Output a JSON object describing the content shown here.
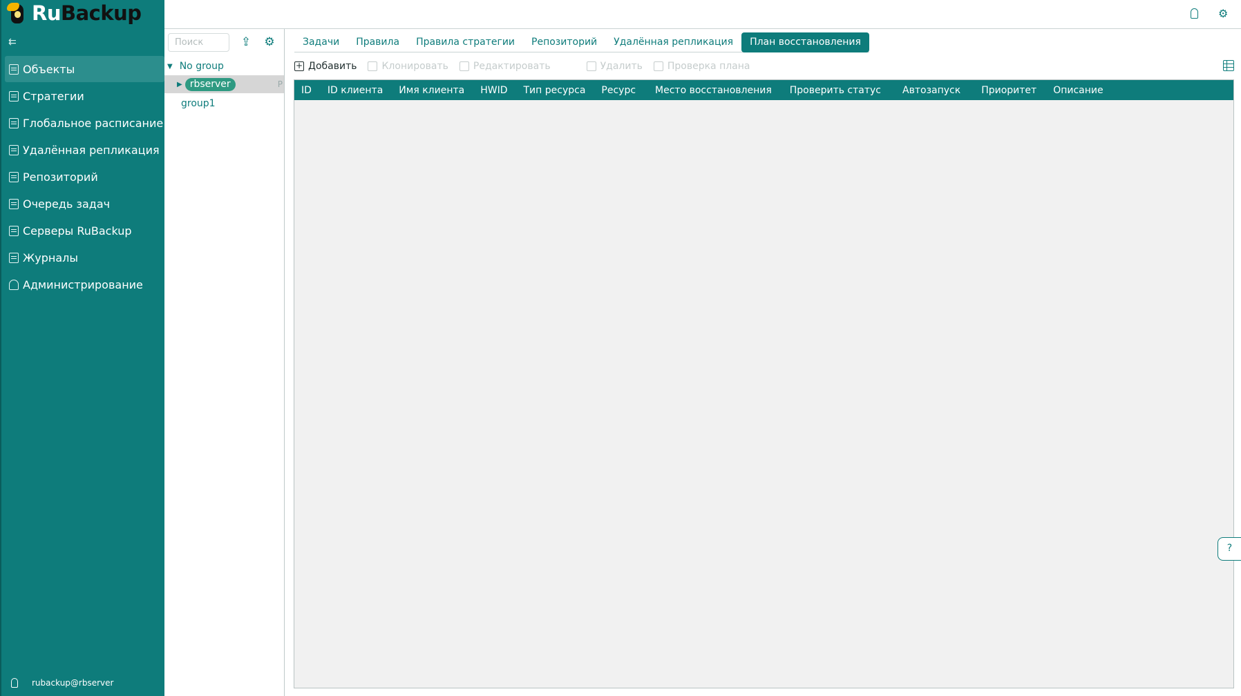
{
  "brand": {
    "ru": "Ru",
    "backup": "Backup"
  },
  "sidebar": {
    "collapse_icon": "collapse-sidebar-icon",
    "items": [
      {
        "label": "Объекты",
        "icon": "monitor-icon",
        "active": true
      },
      {
        "label": "Стратегии",
        "icon": "document-icon"
      },
      {
        "label": "Глобальное расписание",
        "icon": "calendar-icon"
      },
      {
        "label": "Удалённая репликация",
        "icon": "replication-icon"
      },
      {
        "label": "Репозиторий",
        "icon": "storage-icon"
      },
      {
        "label": "Очередь задач",
        "icon": "clipboard-icon"
      },
      {
        "label": "Серверы RuBackup",
        "icon": "server-icon"
      },
      {
        "label": "Журналы",
        "icon": "log-icon"
      },
      {
        "label": "Администрирование",
        "icon": "admin-icon"
      }
    ],
    "footer_user": "rubackup@rbserver"
  },
  "tree": {
    "search_placeholder": "Поиск",
    "no_group": "No group",
    "rbserver": "rbserver",
    "truncated": "P",
    "group1": "group1"
  },
  "tabs": [
    {
      "label": "Задачи"
    },
    {
      "label": "Правила"
    },
    {
      "label": "Правила стратегии"
    },
    {
      "label": "Репозиторий"
    },
    {
      "label": "Удалённая репликация"
    },
    {
      "label": "План восстановления",
      "active": true
    }
  ],
  "toolbar": {
    "add": "Добавить",
    "clone": "Клонировать",
    "edit": "Редактировать",
    "delete": "Удалить",
    "check_plan": "Проверка плана"
  },
  "table": {
    "columns": [
      "ID",
      "ID клиента",
      "Имя клиента",
      "HWID",
      "Тип ресурса",
      "Ресурс",
      "Место восстановления",
      "Проверить статус",
      "Автозапуск",
      "Приоритет",
      "Описание"
    ],
    "rows": []
  },
  "colors": {
    "accent": "#0e7c7b",
    "active_pill": "#2e9a82"
  }
}
